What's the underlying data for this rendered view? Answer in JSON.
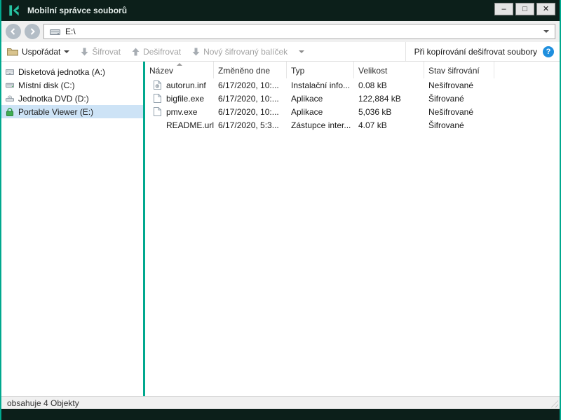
{
  "colors": {
    "accent": "#00a88e",
    "titlebar": "#0c1f1a",
    "selection": "#cde3f6",
    "help": "#1f8fde"
  },
  "window": {
    "title": "Mobilní správce souborů",
    "controls": {
      "minimize": "–",
      "maximize": "□",
      "close": "✕"
    }
  },
  "navbar": {
    "address": "E:\\"
  },
  "toolbar": {
    "organize": "Uspořádat",
    "encrypt": "Šifrovat",
    "decrypt": "Dešifrovat",
    "new_package": "Nový šifrovaný balíček",
    "copy_option": "Při kopírování dešifrovat soubory",
    "help": "?"
  },
  "sidebar": {
    "items": [
      {
        "label": "Disketová jednotka (A:)",
        "icon": "floppy-drive-icon",
        "selected": false
      },
      {
        "label": "Místní disk (C:)",
        "icon": "hard-disk-icon",
        "selected": false
      },
      {
        "label": "Jednotka DVD (D:)",
        "icon": "dvd-drive-icon",
        "selected": false
      },
      {
        "label": "Portable Viewer (E:)",
        "icon": "lock-icon",
        "selected": true
      }
    ]
  },
  "filelist": {
    "columns": [
      "Název",
      "Změněno dne",
      "Typ",
      "Velikost",
      "Stav šifrování"
    ],
    "rows": [
      {
        "name": "autorun.inf",
        "modified": "6/17/2020, 10:...",
        "type": "Instalační info...",
        "size": "0.08 kB",
        "status": "Nešifrované"
      },
      {
        "name": "bigfile.exe",
        "modified": "6/17/2020, 10:...",
        "type": "Aplikace",
        "size": "122,884 kB",
        "status": "Šifrované"
      },
      {
        "name": "pmv.exe",
        "modified": "6/17/2020, 10:...",
        "type": "Aplikace",
        "size": "5,036 kB",
        "status": "Nešifrované"
      },
      {
        "name": "README.url",
        "modified": "6/17/2020, 5:3...",
        "type": "Zástupce inter...",
        "size": "4.07 kB",
        "status": "Šifrované"
      }
    ]
  },
  "statusbar": {
    "text": "obsahuje 4 Objekty"
  }
}
